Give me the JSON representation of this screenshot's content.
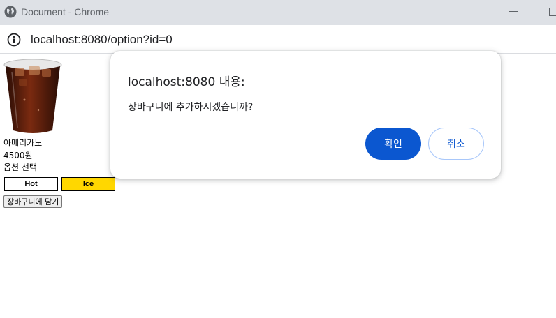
{
  "window": {
    "title": "Document - Chrome"
  },
  "address_bar": {
    "url": "localhost:8080/option?id=0"
  },
  "product": {
    "name": "아메리카노",
    "price": "4500원",
    "option_label": "옵션 선택",
    "options": [
      {
        "label": "Hot",
        "selected": false
      },
      {
        "label": "Ice",
        "selected": true
      }
    ],
    "cart_button": "장바구니에 담기"
  },
  "dialog": {
    "title": "localhost:8080 내용:",
    "message": "장바구니에 추가하시겠습니까?",
    "ok_label": "확인",
    "cancel_label": "취소"
  },
  "colors": {
    "selected_option": "#ffd700",
    "primary_button": "#0b57d0"
  },
  "icons": [
    "globe-icon",
    "minimize-icon",
    "maximize-icon",
    "info-icon"
  ]
}
